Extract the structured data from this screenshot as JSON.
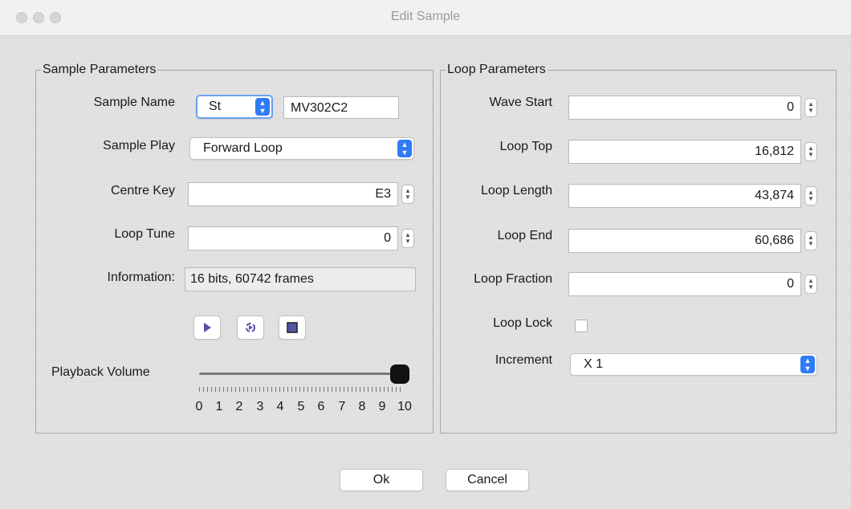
{
  "window": {
    "title": "Edit Sample"
  },
  "sample_parameters": {
    "group_label": "Sample Parameters",
    "sample_name_label": "Sample Name",
    "sample_name_type": "St",
    "sample_name_value": "MV302C2",
    "sample_play_label": "Sample Play",
    "sample_play_value": "Forward Loop",
    "centre_key_label": "Centre Key",
    "centre_key_value": "E3",
    "loop_tune_label": "Loop Tune",
    "loop_tune_value": "0",
    "information_label": "Information:",
    "information_value": "16 bits, 60742 frames",
    "playback_volume_label": "Playback Volume",
    "volume_ticks": [
      "0",
      "1",
      "2",
      "3",
      "4",
      "5",
      "6",
      "7",
      "8",
      "9",
      "10"
    ],
    "volume_level": 10
  },
  "loop_parameters": {
    "group_label": "Loop Parameters",
    "wave_start_label": "Wave Start",
    "wave_start_value": "0",
    "loop_top_label": "Loop Top",
    "loop_top_value": "16,812",
    "loop_length_label": "Loop Length",
    "loop_length_value": "43,874",
    "loop_end_label": "Loop End",
    "loop_end_value": "60,686",
    "loop_fraction_label": "Loop Fraction",
    "loop_fraction_value": "0",
    "loop_lock_label": "Loop Lock",
    "loop_lock_checked": false,
    "increment_label": "Increment",
    "increment_value": "X 1"
  },
  "buttons": {
    "ok_label": "Ok",
    "cancel_label": "Cancel"
  },
  "colors": {
    "accent": "#2f7cf6",
    "icon_purple": "#5552a8"
  },
  "icons": [
    "play-icon",
    "loop-play-icon",
    "stop-icon",
    "chevron-updown-icon"
  ]
}
